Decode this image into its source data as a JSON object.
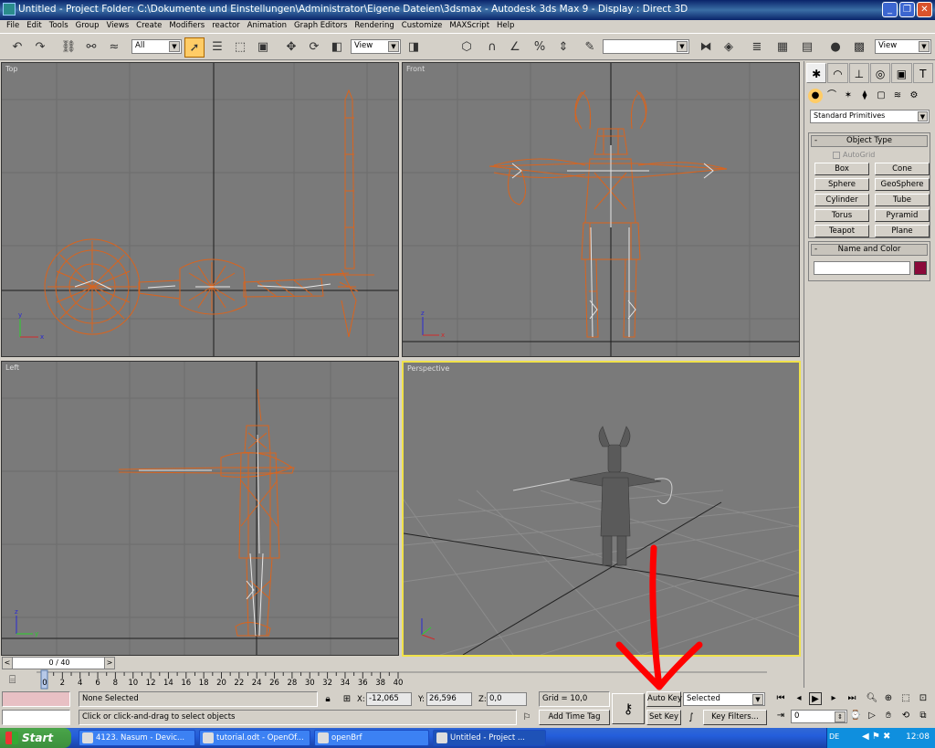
{
  "window": {
    "title": "Untitled     - Project Folder: C:\\Dokumente und Einstellungen\\Administrator\\Eigene Dateien\\3dsmax     - Autodesk 3ds Max 9     - Display : Direct 3D",
    "controls": [
      "minimize-icon",
      "maximize-icon",
      "close-icon"
    ]
  },
  "menu": [
    "File",
    "Edit",
    "Tools",
    "Group",
    "Views",
    "Create",
    "Modifiers",
    "reactor",
    "Animation",
    "Graph Editors",
    "Rendering",
    "Customize",
    "MAXScript",
    "Help"
  ],
  "toolbar": {
    "selection_filter": "All",
    "ref_coord": "View",
    "named_selection": "",
    "right_view": "View",
    "icons": [
      "undo-icon",
      "redo-icon",
      "select-link-icon",
      "unlink-icon",
      "bind-spacewarp-icon",
      "select-object-icon",
      "select-by-name-icon",
      "rect-select-icon",
      "window-crossing-icon",
      "move-icon",
      "rotate-icon",
      "scale-icon",
      "pivot-icon",
      "manipulate-icon",
      "snap-3d-icon",
      "angle-snap-icon",
      "percent-snap-icon",
      "spinner-snap-icon",
      "edit-named-sel-icon",
      "mirror-icon",
      "align-icon",
      "layer-manager-icon",
      "curve-editor-icon",
      "schematic-view-icon",
      "material-editor-icon",
      "render-scene-icon",
      "quick-render-icon"
    ]
  },
  "viewports": [
    {
      "label": "Top"
    },
    {
      "label": "Front"
    },
    {
      "label": "Left"
    },
    {
      "label": "Perspective"
    }
  ],
  "command_panel": {
    "tabs": [
      "create-icon",
      "modify-icon",
      "hierarchy-icon",
      "motion-icon",
      "display-icon",
      "utilities-icon"
    ],
    "subtabs": [
      "geometry-icon",
      "shapes-icon",
      "lights-icon",
      "cameras-icon",
      "helpers-icon",
      "spacewarps-icon",
      "systems-icon"
    ],
    "category": "Standard Primitives",
    "object_type_title": "Object Type",
    "autogrid": "AutoGrid",
    "buttons": [
      "Box",
      "Cone",
      "Sphere",
      "GeoSphere",
      "Cylinder",
      "Tube",
      "Torus",
      "Pyramid",
      "Teapot",
      "Plane"
    ],
    "name_color_title": "Name and Color",
    "name_value": "",
    "object_color": "#8b0a3a"
  },
  "timeline": {
    "frame_label": "0 / 40",
    "ticks": [
      "0",
      "2",
      "4",
      "6",
      "8",
      "10",
      "12",
      "14",
      "16",
      "18",
      "20",
      "22",
      "24",
      "26",
      "28",
      "30",
      "32",
      "34",
      "36",
      "38",
      "40"
    ]
  },
  "status": {
    "selection": "None Selected",
    "prompt": "Click or click-and-drag to select objects",
    "x_label": "X:",
    "x_value": "-12,065",
    "y_label": "Y:",
    "y_value": "26,596",
    "z_label": "Z:",
    "z_value": "0,0",
    "grid": "Grid = 10,0",
    "add_time_tag": "Add Time Tag",
    "auto_key": "Auto Key",
    "set_key": "Set Key",
    "key_mode": "Selected",
    "key_filters": "Key Filters...",
    "current_frame": "0"
  },
  "taskbar": {
    "start": "Start",
    "tasks": [
      "4123. Nasum - Devic...",
      "tutorial.odt - OpenOf...",
      "openBrf",
      "Untitled     - Project ..."
    ],
    "lang": "DE",
    "time": "12:08"
  },
  "colors": {
    "wire": "#d9641e",
    "bones": "#e6e6e6",
    "active_viewport": "#f0e24a",
    "annotation_arrow": "#ff0000"
  }
}
